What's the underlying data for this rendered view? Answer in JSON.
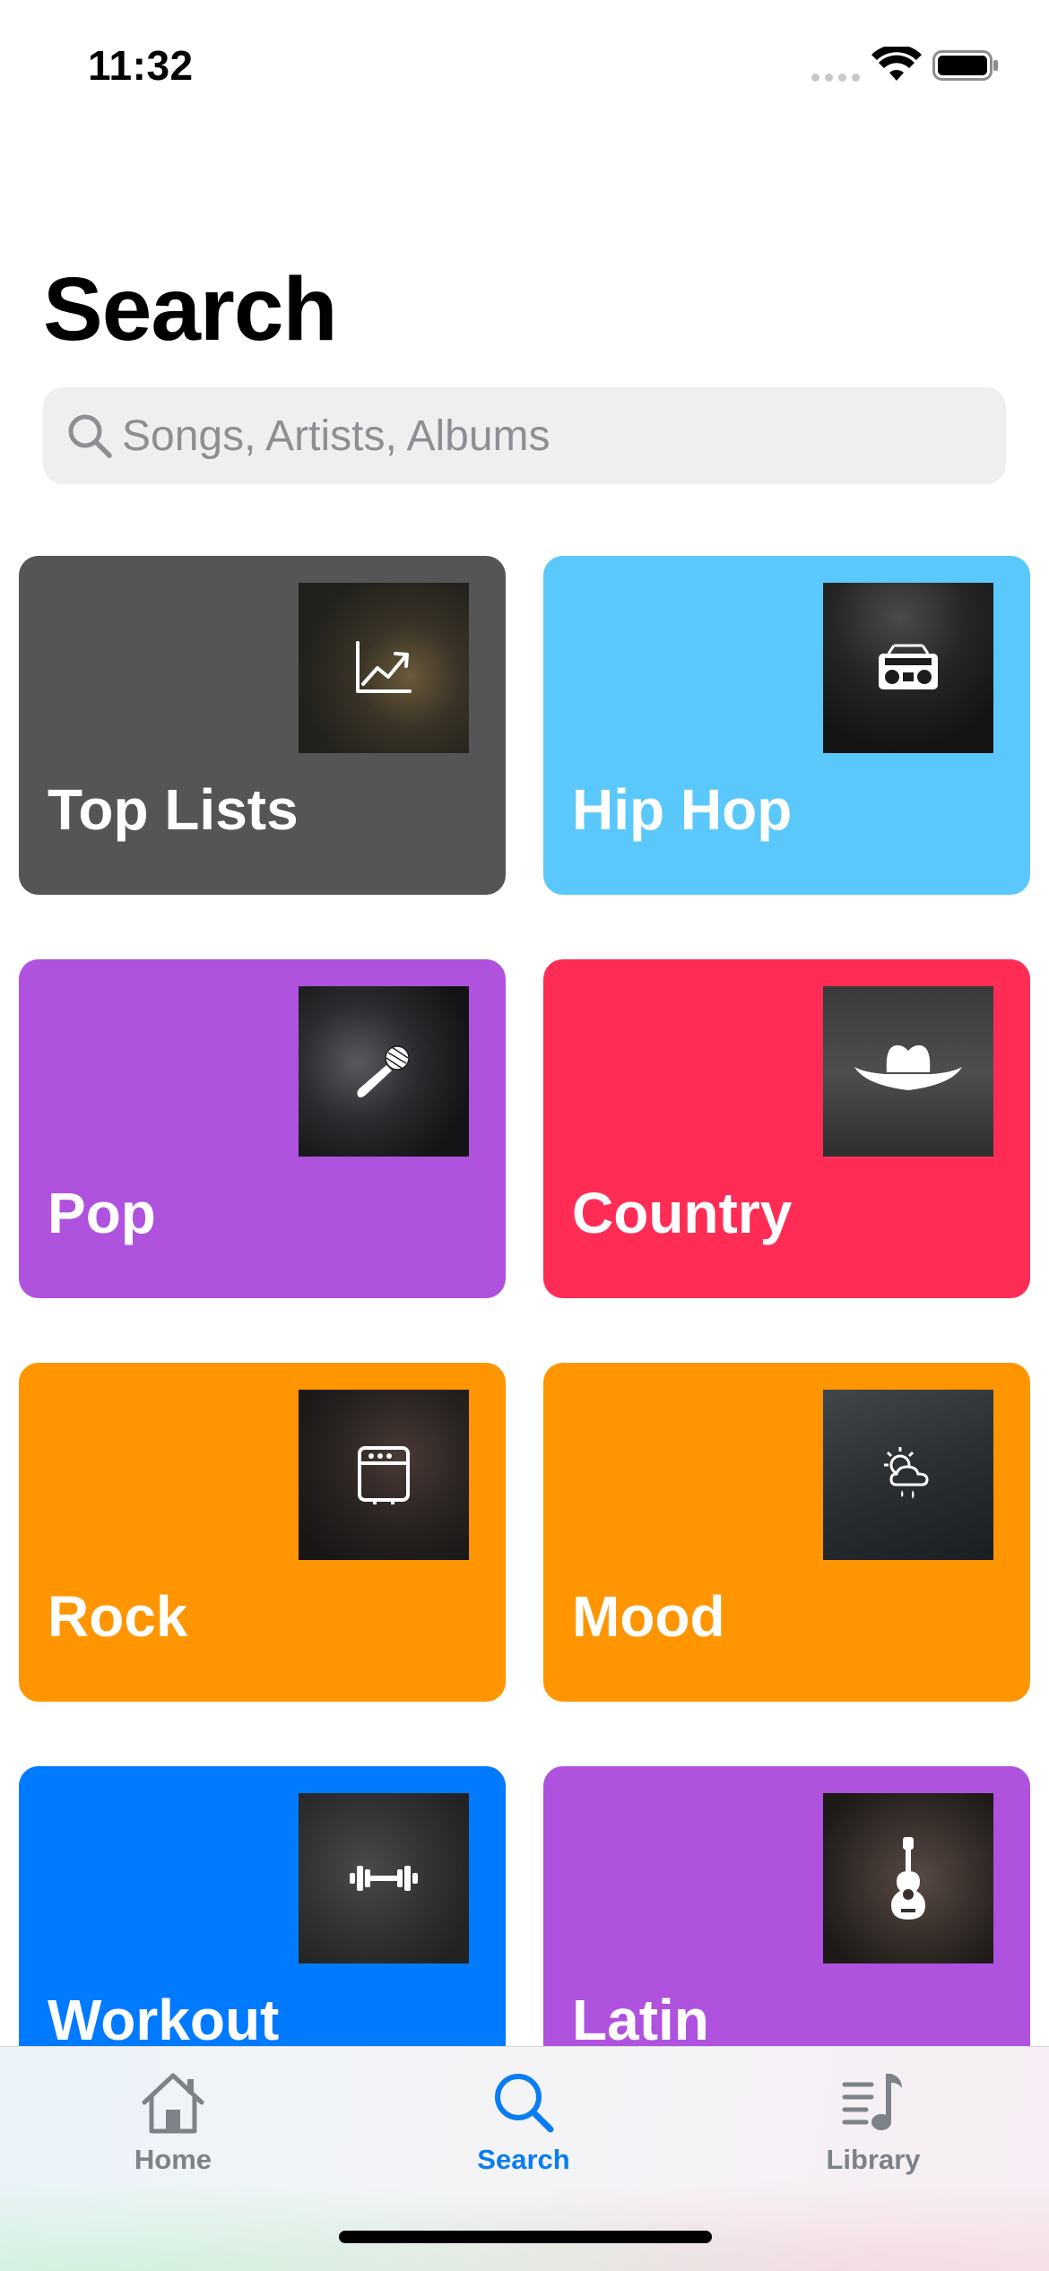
{
  "status_bar": {
    "time": "11:32",
    "icons": [
      "cellular-signal-icon",
      "wifi-icon",
      "battery-icon"
    ]
  },
  "header": {
    "title": "Search"
  },
  "search": {
    "placeholder": "Songs, Artists, Albums",
    "icon": "magnifying-glass-icon"
  },
  "categories": [
    {
      "label": "Top Lists",
      "color": "#555555",
      "icon": "trending-chart-icon"
    },
    {
      "label": "Hip Hop",
      "color": "#5ac8fa",
      "icon": "boombox-icon"
    },
    {
      "label": "Pop",
      "color": "#af52de",
      "icon": "microphone-icon"
    },
    {
      "label": "Country",
      "color": "#ff2d55",
      "icon": "cowboy-hat-icon"
    },
    {
      "label": "Rock",
      "color": "#ff9500",
      "icon": "amplifier-icon"
    },
    {
      "label": "Mood",
      "color": "#ff9500",
      "icon": "sun-rain-cloud-icon"
    },
    {
      "label": "Workout",
      "color": "#007aff",
      "icon": "dumbbell-icon"
    },
    {
      "label": "Latin",
      "color": "#af52de",
      "icon": "guitar-icon"
    }
  ],
  "tab_bar": {
    "active": "Search",
    "active_color": "#0a7cf2",
    "inactive_color": "#7d8288",
    "tabs": [
      {
        "label": "Home",
        "icon": "house-icon"
      },
      {
        "label": "Search",
        "icon": "magnifying-glass-icon"
      },
      {
        "label": "Library",
        "icon": "music-library-icon"
      }
    ]
  }
}
